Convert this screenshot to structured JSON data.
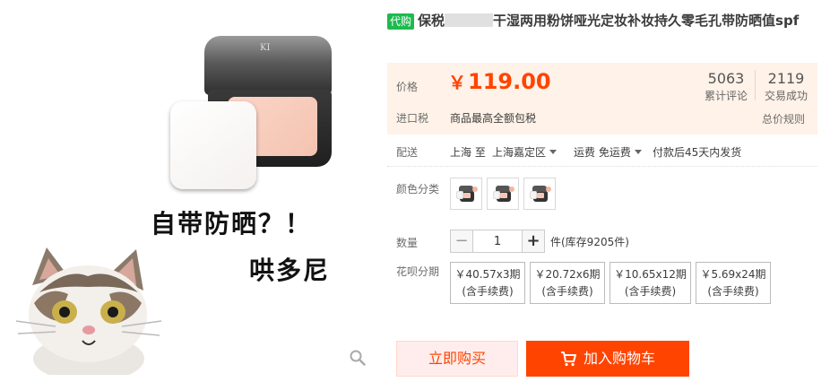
{
  "product": {
    "tag": "代购",
    "title_prefix": "保税",
    "title_suffix": "干湿两用粉饼哑光定妆补妆持久零毛孔带防晒值spf"
  },
  "image": {
    "compact_logo": "KI",
    "caption_line1": "自带防晒？！",
    "caption_line2": "哄多尼"
  },
  "price": {
    "label": "价格",
    "currency": "￥",
    "value": "119.00",
    "tax_label": "进口税",
    "tax_value": "商品最高全额包税",
    "reviews_count": "5063",
    "reviews_label": "累计评论",
    "deals_count": "2119",
    "deals_label": "交易成功",
    "rules_link": "总价规则"
  },
  "shipping": {
    "label": "配送",
    "route": "上海 至",
    "destination": "上海嘉定区",
    "fee": "运费 免运费",
    "delivery": "付款后45天内发货"
  },
  "color": {
    "label": "颜色分类",
    "options": [
      "1",
      "2",
      "3"
    ]
  },
  "quantity": {
    "label": "数量",
    "value": "1",
    "minus": "−",
    "plus": "+",
    "stock": "件(库存9205件)"
  },
  "installment": {
    "label": "花呗分期",
    "plans": [
      {
        "amount": "￥40.57x3期",
        "fee": "(含手续费)"
      },
      {
        "amount": "￥20.72x6期",
        "fee": "(含手续费)"
      },
      {
        "amount": "￥10.65x12期",
        "fee": "(含手续费)"
      },
      {
        "amount": "￥5.69x24期",
        "fee": "(含手续费)"
      }
    ]
  },
  "actions": {
    "buy_now": "立即购买",
    "add_cart": "加入购物车"
  },
  "colors": {
    "accent": "#ff4400",
    "price_bg": "#fff2e8",
    "tag_green": "#1dbb4e"
  }
}
